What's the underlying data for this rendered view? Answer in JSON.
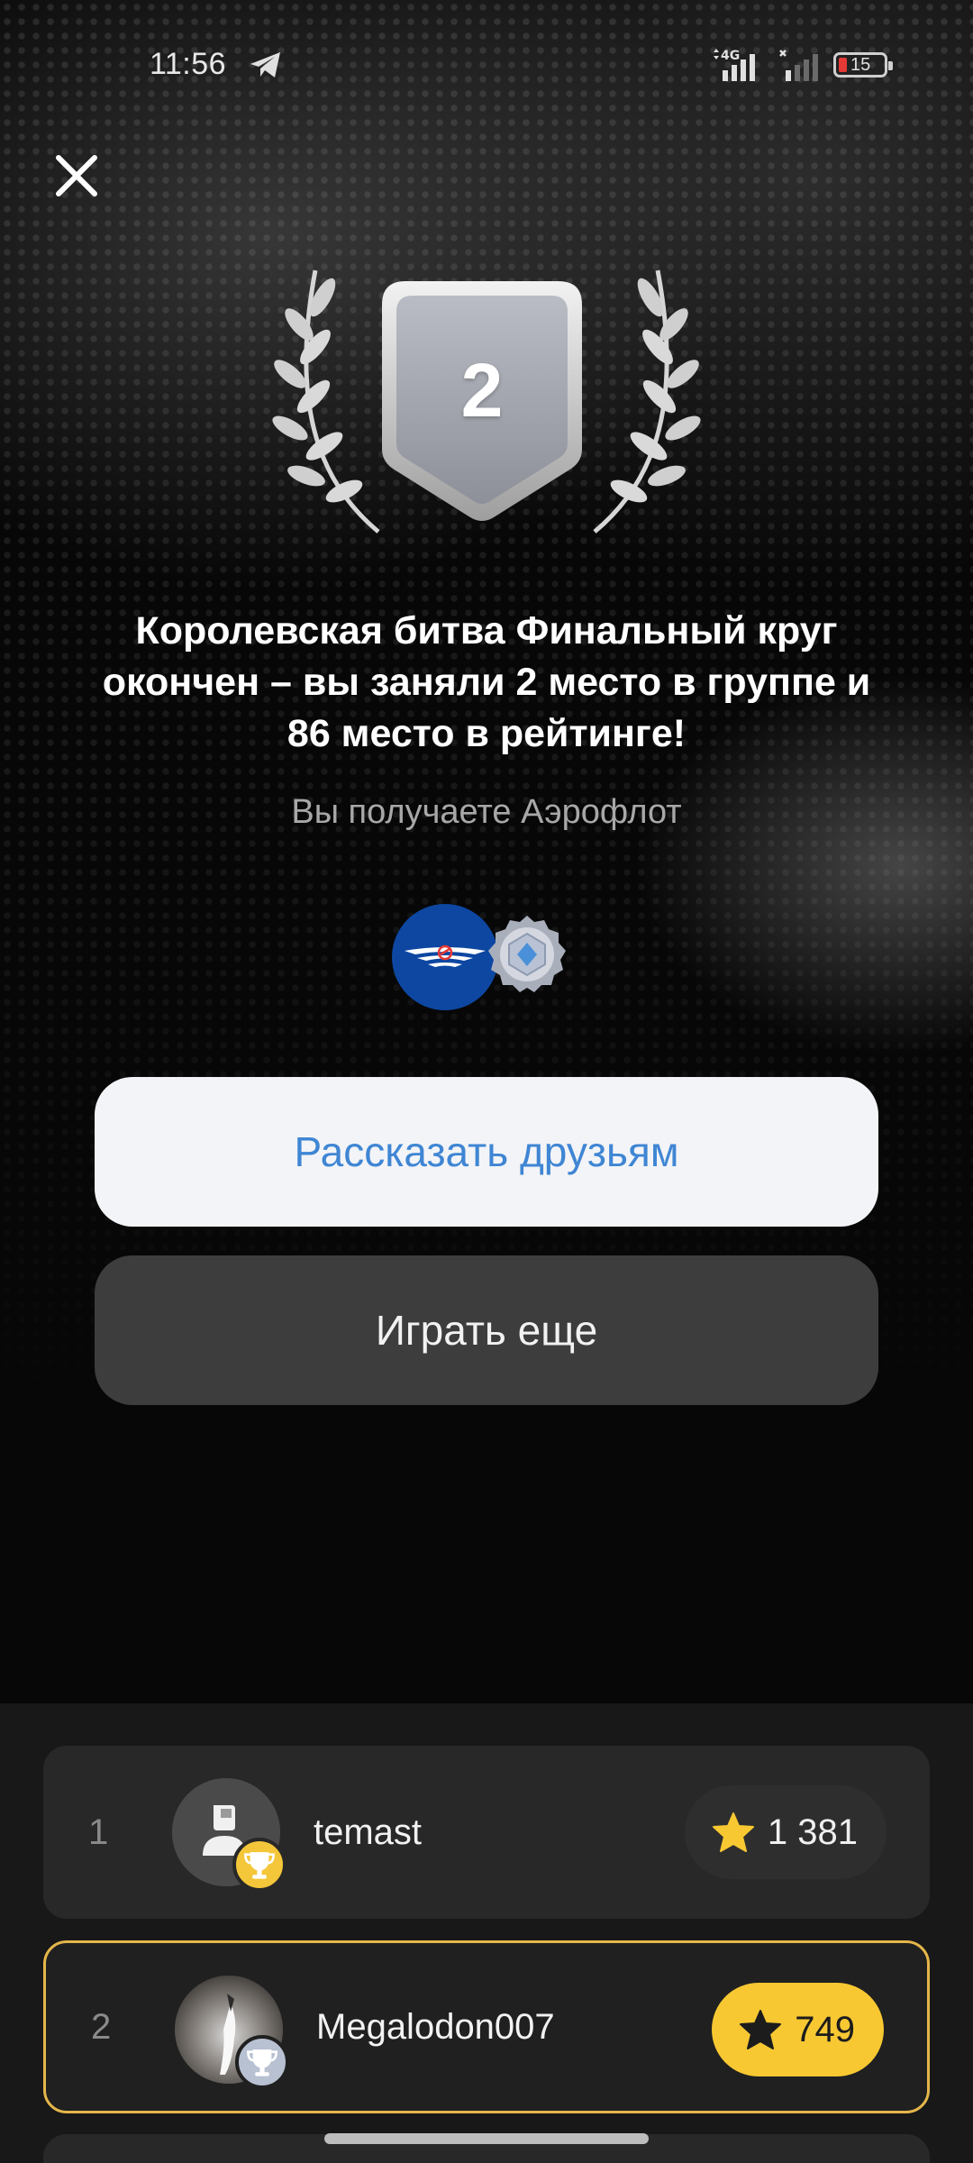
{
  "status_bar": {
    "time": "11:56",
    "network": "4G",
    "battery_level": "15"
  },
  "result": {
    "rank_badge": "2",
    "headline": "Королевская битва Финальный круг окончен – вы заняли 2 место в группе и 86 место в рейтинге!",
    "reward_text": "Вы получаете Аэрофлот"
  },
  "actions": {
    "share_label": "Рассказать друзьям",
    "play_again_label": "Играть еще"
  },
  "leaderboard": [
    {
      "position": "1",
      "name": "temast",
      "score": "1 381",
      "trophy": "gold",
      "highlighted": false
    },
    {
      "position": "2",
      "name": "Megalodon007",
      "score": "749",
      "trophy": "silver",
      "highlighted": true
    }
  ],
  "colors": {
    "accent_blue": "#3f86d4",
    "highlight_gold": "#f7c832",
    "border_gold": "#e4b64a",
    "aeroflot_blue": "#0d47a1"
  },
  "icons": [
    "close-icon",
    "telegram-icon",
    "signal-icon",
    "battery-icon",
    "laurel-icon",
    "shield-icon",
    "aeroflot-logo",
    "diamond-badge-icon",
    "trophy-icon",
    "star-icon",
    "user-icon"
  ]
}
